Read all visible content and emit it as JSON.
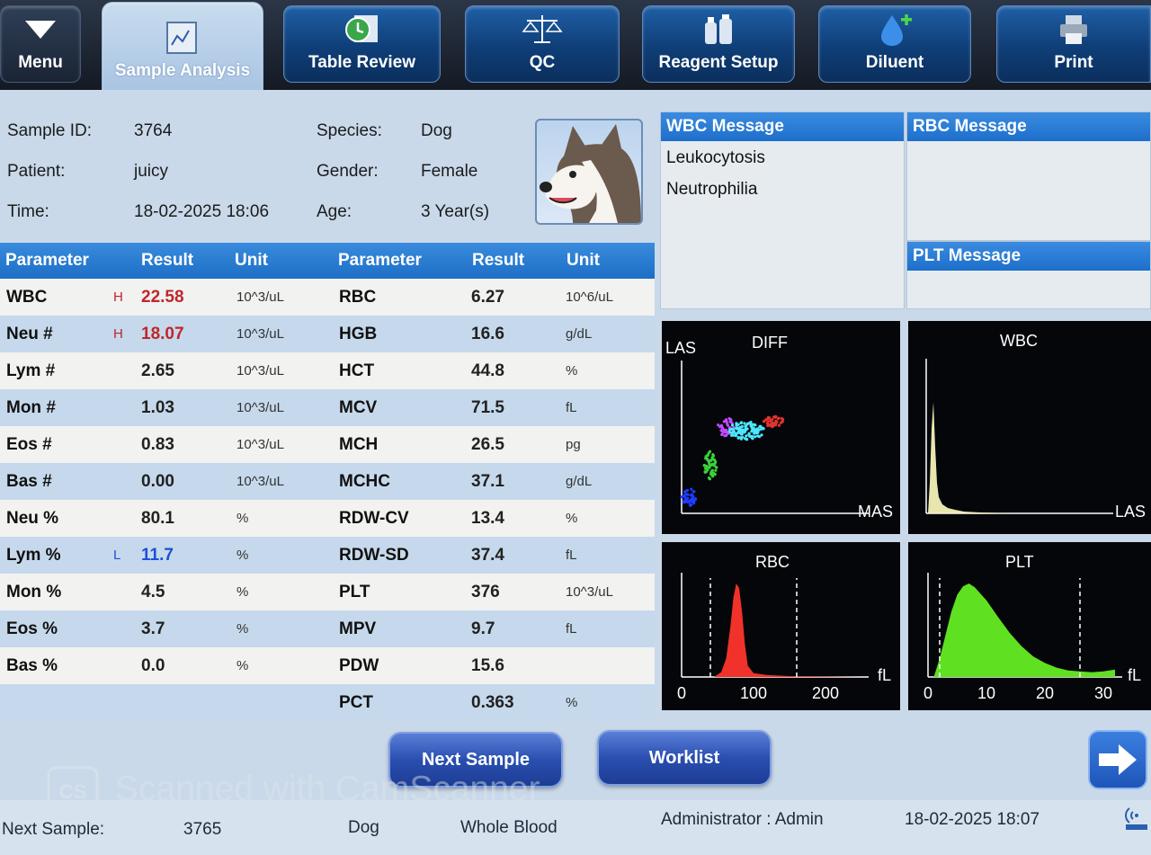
{
  "toolbar": {
    "buttons": [
      {
        "label": "Menu",
        "icon": "down-triangle-icon"
      },
      {
        "label": "Sample Analysis",
        "icon": "chart-icon"
      },
      {
        "label": "Table Review",
        "icon": "table-icon"
      },
      {
        "label": "QC",
        "icon": "scale-icon"
      },
      {
        "label": "Reagent Setup",
        "icon": "reagent-bottles-icon"
      },
      {
        "label": "Diluent",
        "icon": "droplet-plus-icon"
      },
      {
        "label": "Print",
        "icon": "printer-icon"
      }
    ],
    "active": "Sample Analysis"
  },
  "info": {
    "sample_id_label": "Sample ID:",
    "sample_id": "3764",
    "patient_label": "Patient:",
    "patient": "juicy",
    "time_label": "Time:",
    "time": "18-02-2025 18:06",
    "species_label": "Species:",
    "species": "Dog",
    "gender_label": "Gender:",
    "gender": "Female",
    "age_label": "Age:",
    "age": "3 Year(s)"
  },
  "results": {
    "headers": {
      "parameter": "Parameter",
      "result": "Result",
      "unit": "Unit"
    },
    "left": [
      {
        "name": "WBC",
        "flag": "H",
        "result": "22.58",
        "unit": "10^3/uL"
      },
      {
        "name": "Neu #",
        "flag": "H",
        "result": "18.07",
        "unit": "10^3/uL"
      },
      {
        "name": "Lym #",
        "flag": "",
        "result": "2.65",
        "unit": "10^3/uL"
      },
      {
        "name": "Mon #",
        "flag": "",
        "result": "1.03",
        "unit": "10^3/uL"
      },
      {
        "name": "Eos #",
        "flag": "",
        "result": "0.83",
        "unit": "10^3/uL"
      },
      {
        "name": "Bas #",
        "flag": "",
        "result": "0.00",
        "unit": "10^3/uL"
      },
      {
        "name": "Neu %",
        "flag": "",
        "result": "80.1",
        "unit": "%"
      },
      {
        "name": "Lym %",
        "flag": "L",
        "result": "11.7",
        "unit": "%"
      },
      {
        "name": "Mon %",
        "flag": "",
        "result": "4.5",
        "unit": "%"
      },
      {
        "name": "Eos %",
        "flag": "",
        "result": "3.7",
        "unit": "%"
      },
      {
        "name": "Bas %",
        "flag": "",
        "result": "0.0",
        "unit": "%"
      }
    ],
    "right": [
      {
        "name": "RBC",
        "result": "6.27",
        "unit": "10^6/uL"
      },
      {
        "name": "HGB",
        "result": "16.6",
        "unit": "g/dL"
      },
      {
        "name": "HCT",
        "result": "44.8",
        "unit": "%"
      },
      {
        "name": "MCV",
        "result": "71.5",
        "unit": "fL"
      },
      {
        "name": "MCH",
        "result": "26.5",
        "unit": "pg"
      },
      {
        "name": "MCHC",
        "result": "37.1",
        "unit": "g/dL"
      },
      {
        "name": "RDW-CV",
        "result": "13.4",
        "unit": "%"
      },
      {
        "name": "RDW-SD",
        "result": "37.4",
        "unit": "fL"
      },
      {
        "name": "PLT",
        "result": "376",
        "unit": "10^3/uL"
      },
      {
        "name": "MPV",
        "result": "9.7",
        "unit": "fL"
      },
      {
        "name": "PDW",
        "result": "15.6",
        "unit": ""
      },
      {
        "name": "PCT",
        "result": "0.363",
        "unit": "%"
      }
    ],
    "colors": {
      "high": "#c0262b",
      "low": "#1f4fd6"
    }
  },
  "messages": {
    "wbc_title": "WBC Message",
    "wbc_lines": [
      "Leukocytosis",
      "Neutrophilia"
    ],
    "rbc_title": "RBC Message",
    "plt_title": "PLT Message"
  },
  "chart_data": [
    {
      "type": "scatter",
      "title": "DIFF",
      "ylabel": "LAS",
      "xlabel": "MAS",
      "clusters": [
        {
          "name": "",
          "color": "#1f3cff"
        },
        {
          "name": "",
          "color": "#39d23a"
        },
        {
          "name": "",
          "color": "#c04cff"
        },
        {
          "name": "",
          "color": "#4de7ff"
        },
        {
          "name": "",
          "color": "#e0342e"
        }
      ]
    },
    {
      "type": "area",
      "title": "WBC",
      "xlabel": "LAS",
      "color": "#f4f2b8"
    },
    {
      "type": "area",
      "title": "RBC",
      "xlabel": "fL",
      "color": "#f0322a",
      "x_ticks": [
        "0",
        "100",
        "200"
      ],
      "xlim": [
        0,
        250
      ],
      "x": [
        0,
        45,
        55,
        62,
        68,
        72,
        76,
        80,
        84,
        88,
        92,
        100,
        120,
        150,
        250
      ],
      "y": [
        0,
        0,
        0.05,
        0.2,
        0.55,
        0.85,
        1.0,
        0.95,
        0.7,
        0.35,
        0.12,
        0.04,
        0.02,
        0.01,
        0
      ],
      "markers": [
        40,
        160
      ]
    },
    {
      "type": "area",
      "title": "PLT",
      "xlabel": "fL",
      "color": "#5fe020",
      "x_ticks": [
        "0",
        "10",
        "20",
        "30"
      ],
      "xlim": [
        0,
        32
      ],
      "x": [
        1,
        2,
        3,
        4,
        5,
        6,
        7,
        8,
        10,
        12,
        14,
        16,
        18,
        20,
        22,
        24,
        26,
        28,
        30,
        32
      ],
      "y": [
        0,
        0.2,
        0.45,
        0.7,
        0.88,
        0.97,
        1.0,
        0.96,
        0.82,
        0.64,
        0.47,
        0.33,
        0.22,
        0.15,
        0.1,
        0.07,
        0.06,
        0.05,
        0.06,
        0.08
      ],
      "markers": [
        2,
        26
      ]
    }
  ],
  "buttons": {
    "next_sample": "Next Sample",
    "worklist": "Worklist"
  },
  "status": {
    "next_sample_label": "Next Sample:",
    "next_sample_id": "3765",
    "species": "Dog",
    "sample_type": "Whole Blood",
    "user": "Administrator : Admin",
    "datetime": "18-02-2025 18:07"
  },
  "watermark": {
    "text": "Scanned with CamScanner",
    "badge": "CS"
  }
}
